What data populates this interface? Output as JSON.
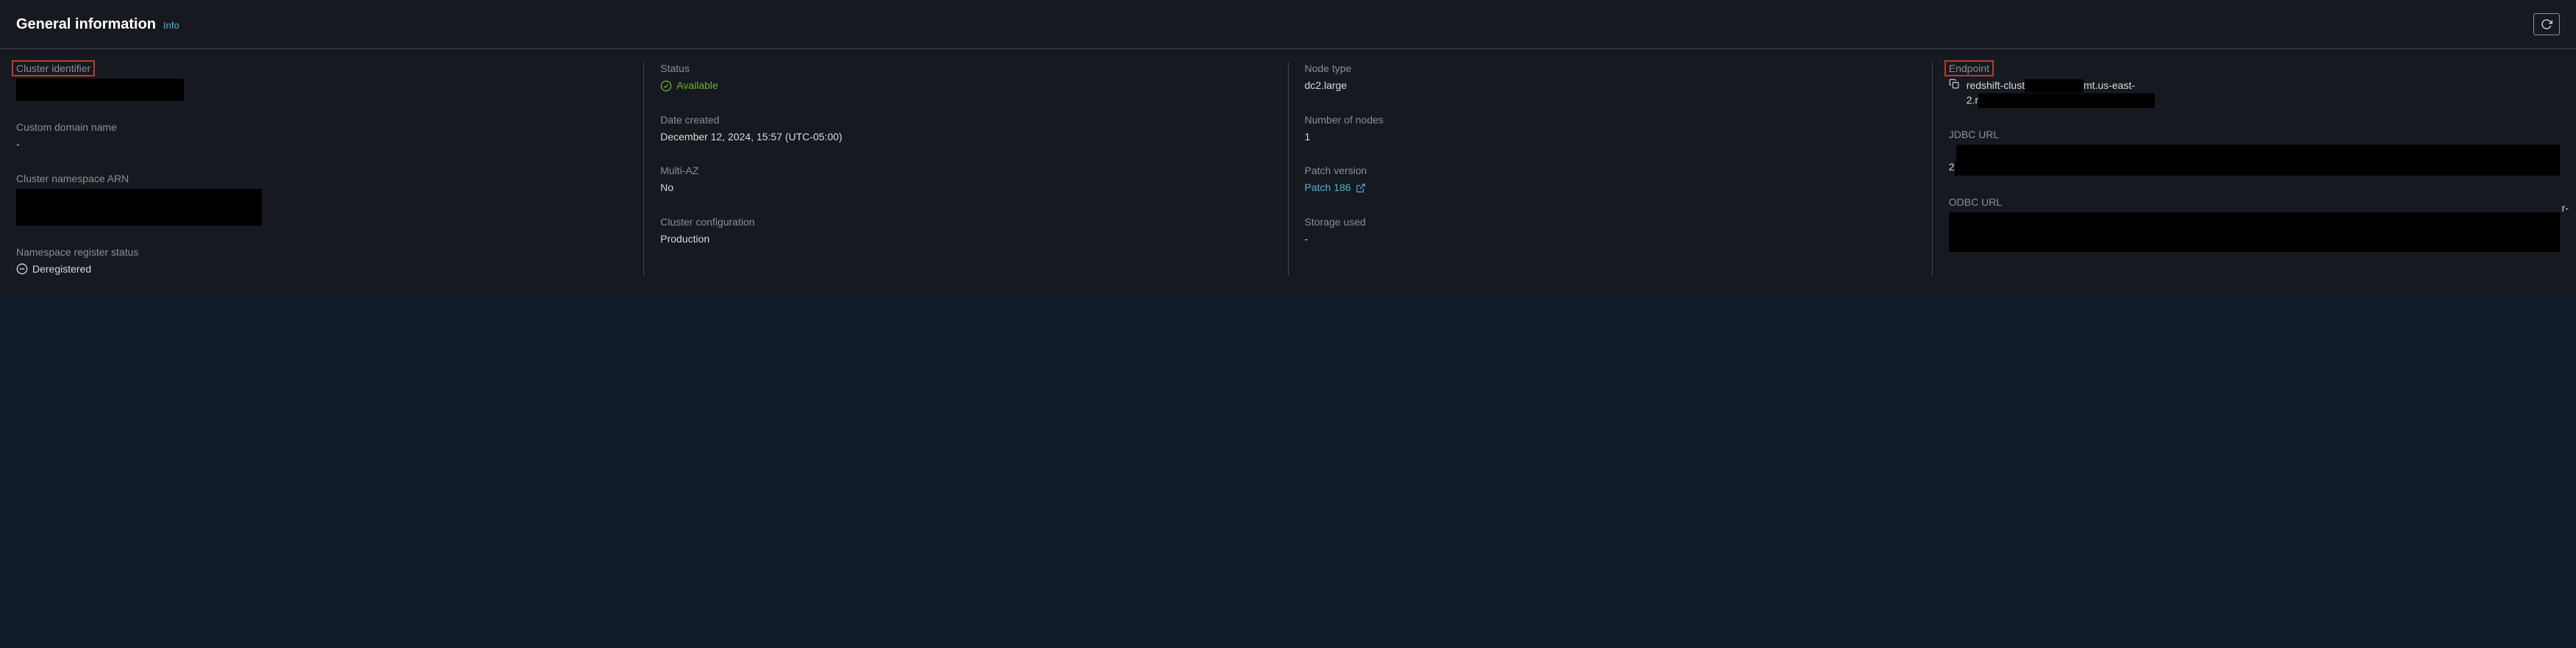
{
  "header": {
    "title": "General information",
    "info_link": "Info"
  },
  "col1": {
    "cluster_identifier": {
      "label": "Cluster identifier"
    },
    "custom_domain": {
      "label": "Custom domain name",
      "value": "-"
    },
    "cluster_arn": {
      "label": "Cluster namespace ARN"
    },
    "register_status": {
      "label": "Namespace register status",
      "value": "Deregistered"
    }
  },
  "col2": {
    "status": {
      "label": "Status",
      "value": "Available"
    },
    "date_created": {
      "label": "Date created",
      "value": "December 12, 2024, 15:57 (UTC-05:00)"
    },
    "multi_az": {
      "label": "Multi-AZ",
      "value": "No"
    },
    "cluster_config": {
      "label": "Cluster configuration",
      "value": "Production"
    }
  },
  "col3": {
    "node_type": {
      "label": "Node type",
      "value": "dc2.large"
    },
    "num_nodes": {
      "label": "Number of nodes",
      "value": "1"
    },
    "patch": {
      "label": "Patch version",
      "value": "Patch 186"
    },
    "storage": {
      "label": "Storage used",
      "value": "-"
    }
  },
  "col4": {
    "endpoint": {
      "label": "Endpoint",
      "prefix": "redshift-clust",
      "suffix1": "mt.us-east-",
      "line2_prefix": "2.r"
    },
    "jdbc": {
      "label": "JDBC URL"
    },
    "odbc": {
      "label": "ODBC URL",
      "overflow_char": "r-"
    }
  }
}
